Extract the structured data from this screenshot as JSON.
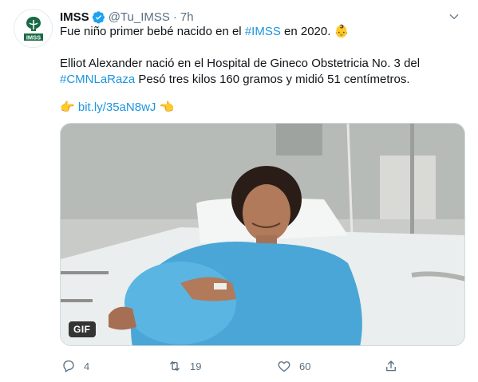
{
  "tweet": {
    "author_name": "IMSS",
    "handle": "@Tu_IMSS",
    "separator": "·",
    "time": "7h",
    "avatar_text": "IMSS",
    "line1_text": "Fue niño primer bebé nacido en el ",
    "line1_hashtag": "#IMSS",
    "line1_tail": " en 2020.",
    "line1_emoji": "👶",
    "line2_text": "Elliot Alexander nació en el Hospital de Gineco Obstetricia No. 3 del",
    "line3_hashtag": "#CMNLaRaza",
    "line3_text": " Pesó tres kilos 160 gramos y midió 51 centímetros.",
    "link_emoji_left": "👉",
    "link_text": "bit.ly/35aN8wJ",
    "link_emoji_right": "👈",
    "media_badge": "GIF"
  },
  "actions": {
    "reply_count": "4",
    "retweet_count": "19",
    "like_count": "60"
  },
  "colors": {
    "link": "#1b95e0",
    "verified": "#1da1f2",
    "muted": "#5b7083",
    "imss_green": "#1a6b45"
  },
  "icons": [
    "verified-icon",
    "chevron-down-icon",
    "reply-icon",
    "retweet-icon",
    "like-icon",
    "share-icon"
  ]
}
